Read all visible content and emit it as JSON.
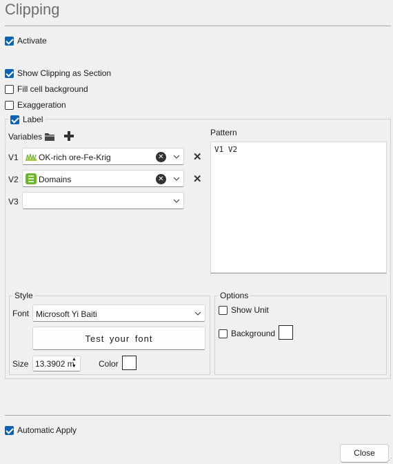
{
  "title": "Clipping",
  "activate": {
    "label": "Activate",
    "checked": true
  },
  "show_section": {
    "label": "Show Clipping as Section",
    "checked": true
  },
  "fill_bg": {
    "label": "Fill cell background",
    "checked": false
  },
  "exaggeration": {
    "label": "Exaggeration",
    "checked": false
  },
  "label_group": {
    "label": "Label",
    "checked": true,
    "variables_label": "Variables",
    "variables": [
      {
        "key": "V1",
        "value": "OK-rich ore-Fe-Krig",
        "icon": "grid-variable-icon"
      },
      {
        "key": "V2",
        "value": "Domains",
        "icon": "category-variable-icon"
      },
      {
        "key": "V3",
        "value": ""
      }
    ],
    "pattern_label": "Pattern",
    "pattern_value": "V1 V2"
  },
  "style": {
    "legend": "Style",
    "font_label": "Font",
    "font_value": "Microsoft Yi Baiti",
    "test_text": "Test your font",
    "size_label": "Size",
    "size_value": "13.3902 m",
    "color_label": "Color",
    "color_value": "#ffffff"
  },
  "options": {
    "legend": "Options",
    "show_unit": {
      "label": "Show Unit",
      "checked": false
    },
    "background": {
      "label": "Background",
      "checked": false,
      "color": "#ffffff"
    }
  },
  "auto_apply": {
    "label": "Automatic Apply",
    "checked": true
  },
  "close_label": "Close",
  "colors": {
    "accent": "#0a64b4",
    "title": "#6e6e6e"
  }
}
